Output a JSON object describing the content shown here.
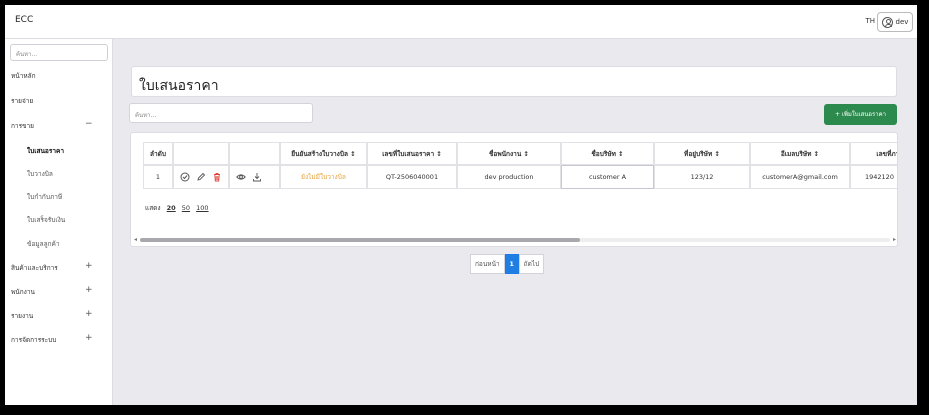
{
  "header": {
    "app_name": "ECC",
    "language": "TH",
    "user_name": "dev"
  },
  "sidebar": {
    "search_placeholder": "ค้นหา...",
    "items": [
      {
        "label": "หน้าหลัก",
        "toggle": ""
      },
      {
        "label": "รายจ่าย",
        "toggle": ""
      },
      {
        "label": "การขาย",
        "toggle": "−"
      },
      {
        "label": "ใบเสนอราคา",
        "toggle": ""
      },
      {
        "label": "ใบวางบิล",
        "toggle": ""
      },
      {
        "label": "ใบกำกับภาษี",
        "toggle": ""
      },
      {
        "label": "ใบเสร็จรับเงิน",
        "toggle": ""
      },
      {
        "label": "ข้อมูลลูกค้า",
        "toggle": ""
      },
      {
        "label": "สินค้าและบริการ",
        "toggle": "+"
      },
      {
        "label": "พนักงาน",
        "toggle": "+"
      },
      {
        "label": "รายงาน",
        "toggle": "+"
      },
      {
        "label": "การจัดการระบบ",
        "toggle": "+"
      }
    ]
  },
  "page": {
    "title": "ใบเสนอราคา",
    "search_placeholder": "ค้นหา...",
    "add_button": "+ เพิ่มใบเสนอราคา"
  },
  "table": {
    "columns": [
      "ลำดับ",
      "ยืนยันสร้างใบวางบิล ↕",
      "เลขที่ใบเสนอราคา ↕",
      "ชื่อพนักงาน ↕",
      "ชื่อบริษัท ↕",
      "ที่อยู่บริษัท ↕",
      "อีเมลบริษัท ↕",
      "เลขที่ภาษี"
    ],
    "rows": [
      {
        "index": "1",
        "status": "ยังไม่มีใบวางบิล",
        "quote_no": "QT-2506040001",
        "employee": "dev production",
        "company": "customer A",
        "address": "123/12",
        "email": "customerA@gmail.com",
        "tax_id": "1942120"
      }
    ],
    "icons": [
      "check-circle-icon",
      "edit-pencil-icon",
      "delete-trash-icon",
      "view-eye-icon",
      "download-icon"
    ],
    "accent_colors": {
      "delete": "#e0453a",
      "status_warning": "#e6a23c",
      "primary": "#1e7ee4",
      "add_button": "#2d8a4e"
    }
  },
  "page_size": {
    "label": "แสดง",
    "options": [
      "20",
      "50",
      "100"
    ],
    "selected": "20"
  },
  "pagination": {
    "prev": "ก่อนหน้า",
    "current": "1",
    "next": "ถัดไป"
  }
}
